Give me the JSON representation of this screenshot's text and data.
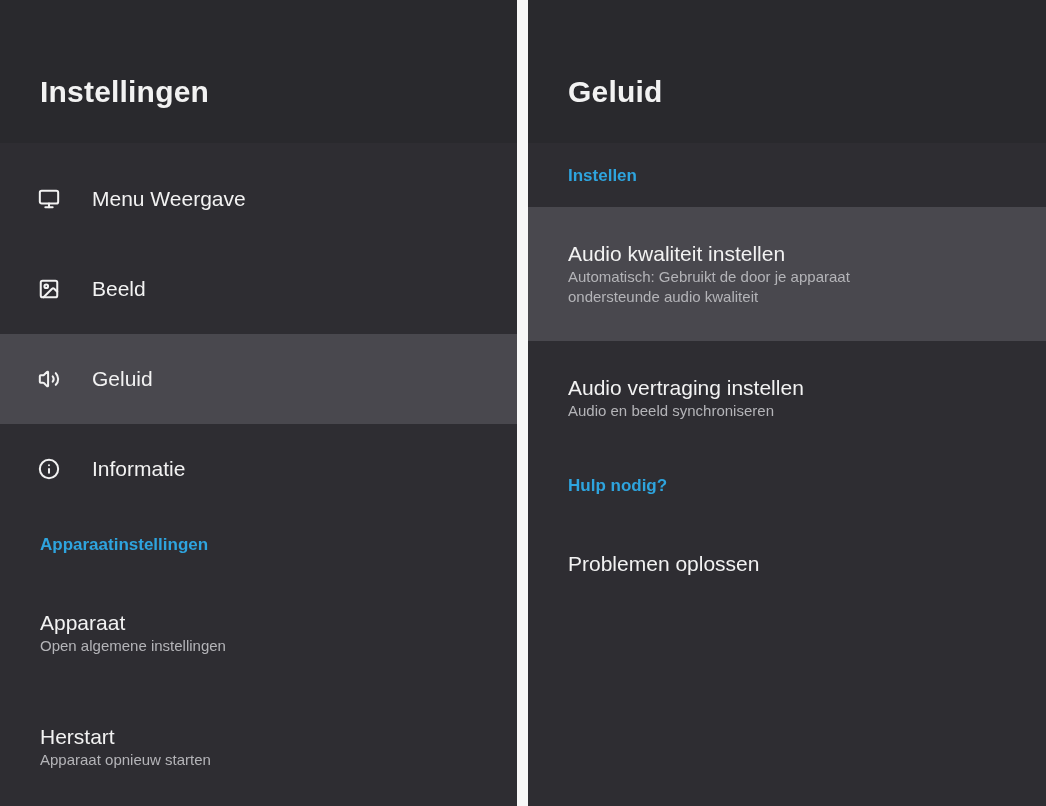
{
  "settings_panel": {
    "title": "Instellingen",
    "items": [
      {
        "kind": "category",
        "label": "Menu Weergave",
        "selected": false
      },
      {
        "kind": "category",
        "label": "Beeld",
        "selected": false
      },
      {
        "kind": "category",
        "label": "Geluid",
        "selected": true
      },
      {
        "kind": "category",
        "label": "Informatie",
        "selected": false
      },
      {
        "kind": "section",
        "label": "Apparaatinstellingen"
      },
      {
        "kind": "entry",
        "label": "Apparaat",
        "description": "Open algemene instellingen",
        "selected": false
      },
      {
        "kind": "entry",
        "label": "Herstart",
        "description": "Apparaat opnieuw starten",
        "selected": false
      }
    ]
  },
  "sound_panel": {
    "title": "Geluid",
    "items": [
      {
        "kind": "section",
        "label": "Instellen"
      },
      {
        "kind": "entry",
        "label": "Audio kwaliteit instellen",
        "description": "Automatisch: Gebruikt de door je apparaat ondersteunde audio kwaliteit",
        "selected": true
      },
      {
        "kind": "entry",
        "label": "Audio vertraging instellen",
        "description": "Audio en beeld synchroniseren",
        "selected": false
      },
      {
        "kind": "section",
        "label": "Hulp nodig?"
      },
      {
        "kind": "entry",
        "label": "Problemen oplossen",
        "selected": false
      }
    ]
  }
}
